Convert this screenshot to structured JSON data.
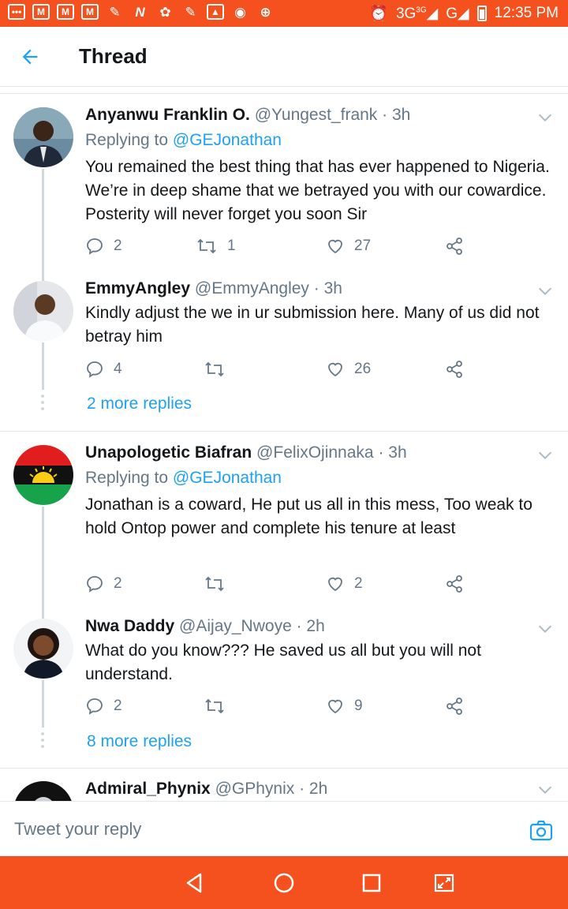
{
  "status_bar": {
    "time": "12:35 PM",
    "network1": "3G",
    "network1_sup": "3G",
    "network2": "G",
    "notif_icons": [
      "message-icon",
      "gmail-icon",
      "gmail-icon",
      "gmail-icon",
      "broom-icon",
      "n-icon",
      "app-icon",
      "broom-icon",
      "image-icon",
      "record-icon",
      "alert-icon"
    ]
  },
  "header": {
    "title": "Thread"
  },
  "tweets": [
    {
      "name": "Anyanwu Franklin O.",
      "handle": "@Yungest_frank",
      "time": "· 3h",
      "replying_prefix": "Replying to ",
      "replying_to": "@GEJonathan",
      "text": "You remained the best thing that has ever happened to Nigeria. We’re in deep shame that we betrayed you with our cowardice. Posterity will never forget you soon Sir",
      "replies": "2",
      "retweets": "1",
      "likes": "27"
    },
    {
      "name": "EmmyAngley",
      "handle": "@EmmyAngley",
      "time": "· 3h",
      "text": "Kindly adjust the we in ur submission here. Many of us did not betray him",
      "replies": "4",
      "retweets": "",
      "likes": "26"
    },
    {
      "name": "Unapologetic Biafran",
      "handle": "@FelixOjinnaka",
      "time": "· 3h",
      "replying_prefix": "Replying to ",
      "replying_to": "@GEJonathan",
      "text": "Jonathan is a coward, He put us all in this mess, Too weak to hold Ontop power and complete his tenure at least",
      "replies": "2",
      "retweets": "",
      "likes": "2"
    },
    {
      "name": "Nwa Daddy",
      "handle": "@Aijay_Nwoye",
      "time": "· 2h",
      "text": "What do you know??? He saved us all but you will not understand.",
      "replies": "2",
      "retweets": "",
      "likes": "9"
    },
    {
      "name": "Admiral_Phynix",
      "handle": "@GPhynix",
      "time": "· 2h"
    }
  ],
  "more_replies": [
    "2 more replies",
    "8 more replies"
  ],
  "compose": {
    "placeholder": "Tweet your reply"
  },
  "colors": {
    "accent": "#1da1f2",
    "status_bar": "#f4511e",
    "muted": "#657786"
  }
}
